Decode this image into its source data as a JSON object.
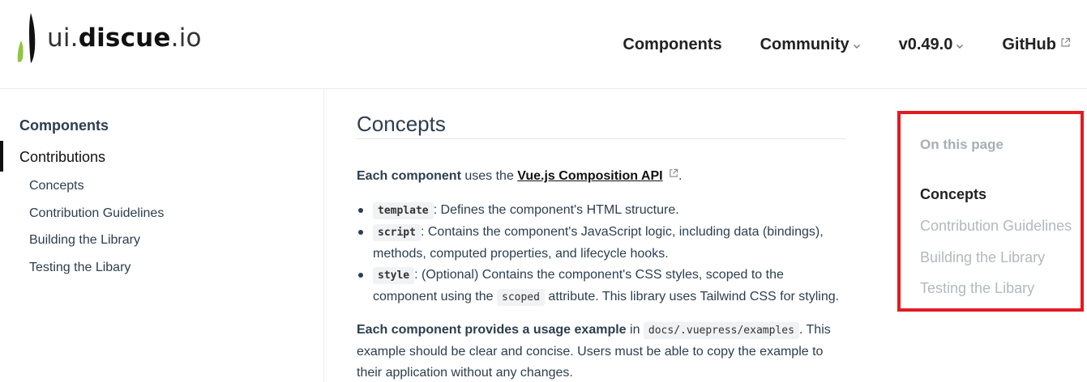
{
  "brand": {
    "name_prefix": "ui.",
    "name_main": "discue",
    "name_suffix": ".io",
    "mark_color": "#8dc63f"
  },
  "nav": {
    "components": "Components",
    "community": "Community",
    "version": "v0.49.0",
    "github": "GitHub"
  },
  "sidebar": {
    "group_components": "Components",
    "group_contributions": "Contributions",
    "items": [
      "Concepts",
      "Contribution Guidelines",
      "Building the Library",
      "Testing the Libary"
    ]
  },
  "content": {
    "title": "Concepts",
    "intro_bold": "Each component",
    "intro_text": " uses the ",
    "intro_link": "Vue.js Composition API",
    "intro_end": ".",
    "bullets": [
      {
        "code": "template",
        "text": ": Defines the component's HTML structure."
      },
      {
        "code": "script",
        "text": ": Contains the component's JavaScript logic, including data (bindings), methods, computed properties, and lifecycle hooks."
      },
      {
        "code": "style",
        "text_before": ": (Optional) Contains the component's CSS styles, scoped to the component using the ",
        "inline_code": "scoped",
        "text_after": " attribute. This library uses Tailwind CSS for styling."
      }
    ],
    "example_bold": "Each component provides a usage example",
    "example_in": " in ",
    "example_code": "docs/.vuepress/examples",
    "example_text": ". This example should be clear and concise. Users must be able to copy the example to their application without any changes."
  },
  "toc": {
    "heading": "On this page",
    "items": [
      "Concepts",
      "Contribution Guidelines",
      "Building the Library",
      "Testing the Libary"
    ],
    "highlight_color": "#e11b22"
  }
}
